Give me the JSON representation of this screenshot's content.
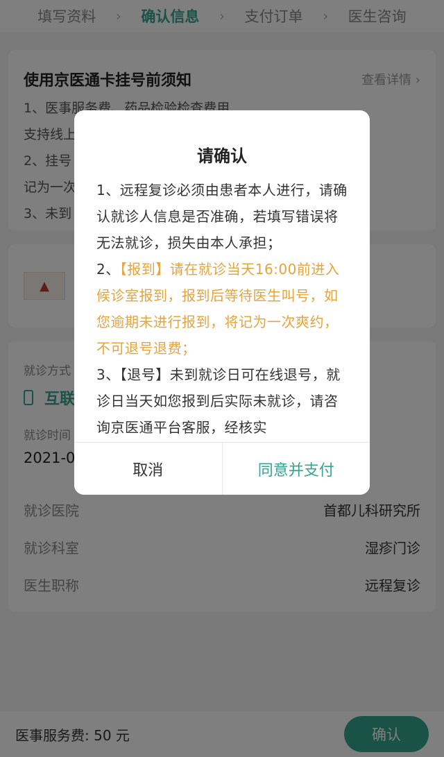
{
  "steps": [
    "填写资料",
    "确认信息",
    "支付订单",
    "医生咨询"
  ],
  "notice": {
    "title": "使用京医通卡挂号前须知",
    "more": "查看详情",
    "lines": [
      "1、医事服务费、药品检验检查费用",
      "支持线上",
      "2、挂号",
      "记为一次",
      "3、未到"
    ]
  },
  "visit": {
    "mode_label": "就诊方式",
    "mode_value": "互联",
    "time_label": "就诊时间",
    "time_value": "2021-0",
    "hospital_label": "就诊医院",
    "hospital_value": "首都儿科研究所",
    "dept_label": "就诊科室",
    "dept_value": "湿疹门诊",
    "title_label": "医生职称",
    "title_value": "远程复诊"
  },
  "bottom": {
    "fee_label": "医事服务费:",
    "fee_value": "50 元",
    "confirm": "确认"
  },
  "dialog": {
    "title": "请确认",
    "p1": "1、远程复诊必须由患者本人进行，请确认就诊人信息是否准确，若填写错误将无法就诊，损失由本人承担；",
    "p2_prefix": "2、",
    "p2_warn": "【报到】请在就诊当天16:00前进入候诊室报到，报到后等待医生叫号，如您逾期未进行报到，将记为一次爽约，不可退号退费；",
    "p3": "3、【退号】未到就诊日可在线退号，就诊日当天如您报到后实际未就诊，请咨询京医通平台客服，经核实",
    "cancel": "取消",
    "agree": "同意并支付"
  }
}
